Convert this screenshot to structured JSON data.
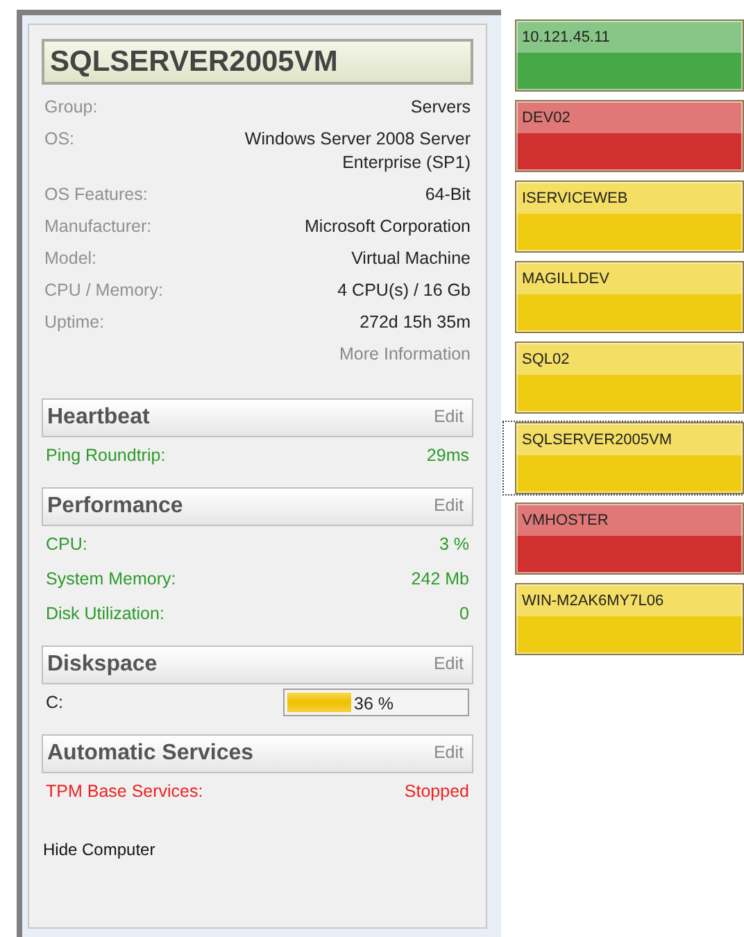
{
  "computer": {
    "name": "SQLSERVER2005VM",
    "properties": [
      {
        "label": "Group:",
        "value": "Servers"
      },
      {
        "label": "OS:",
        "value": "Windows Server 2008 Server Enterprise (SP1)"
      },
      {
        "label": "OS Features:",
        "value": "64-Bit"
      },
      {
        "label": "Manufacturer:",
        "value": "Microsoft Corporation"
      },
      {
        "label": "Model:",
        "value": "Virtual Machine"
      },
      {
        "label": "CPU / Memory:",
        "value": "4 CPU(s) / 16 Gb"
      },
      {
        "label": "Uptime:",
        "value": "272d 15h 35m"
      }
    ],
    "more_link": "More Information"
  },
  "sections": [
    {
      "title": "Heartbeat",
      "edit": "Edit",
      "rows": [
        {
          "kind": "metric",
          "label": "Ping Roundtrip:",
          "value": "29ms"
        }
      ]
    },
    {
      "title": "Performance",
      "edit": "Edit",
      "rows": [
        {
          "kind": "metric",
          "label": "CPU:",
          "value": "3 %"
        },
        {
          "kind": "metric",
          "label": "System Memory:",
          "value": "242 Mb"
        },
        {
          "kind": "metric",
          "label": "Disk Utilization:",
          "value": "0"
        }
      ]
    },
    {
      "title": "Diskspace",
      "edit": "Edit",
      "rows": [
        {
          "kind": "disk",
          "label": "C:",
          "level": 0.36,
          "reading": "36 %"
        }
      ]
    },
    {
      "title": "Automatic Services",
      "edit": "Edit",
      "rows": [
        {
          "kind": "alert",
          "label": "TPM Base Services:",
          "value": "Stopped"
        }
      ]
    }
  ],
  "hide_link": "Hide Computer",
  "tiles": [
    {
      "name": "10.121.45.11",
      "color": "#47a847",
      "selected": false
    },
    {
      "name": "DEV02",
      "color": "#d03030",
      "selected": false
    },
    {
      "name": "ISERVICEWEB",
      "color": "#efcc12",
      "selected": false
    },
    {
      "name": "MAGILLDEV",
      "color": "#efcc12",
      "selected": false
    },
    {
      "name": "SQL02",
      "color": "#efcc12",
      "selected": false
    },
    {
      "name": "SQLSERVER2005VM",
      "color": "#efcc12",
      "selected": true
    },
    {
      "name": "VMHOSTER",
      "color": "#d03030",
      "selected": false
    },
    {
      "name": "WIN-M2AK6MY7L06",
      "color": "#efcc12",
      "selected": false
    }
  ]
}
